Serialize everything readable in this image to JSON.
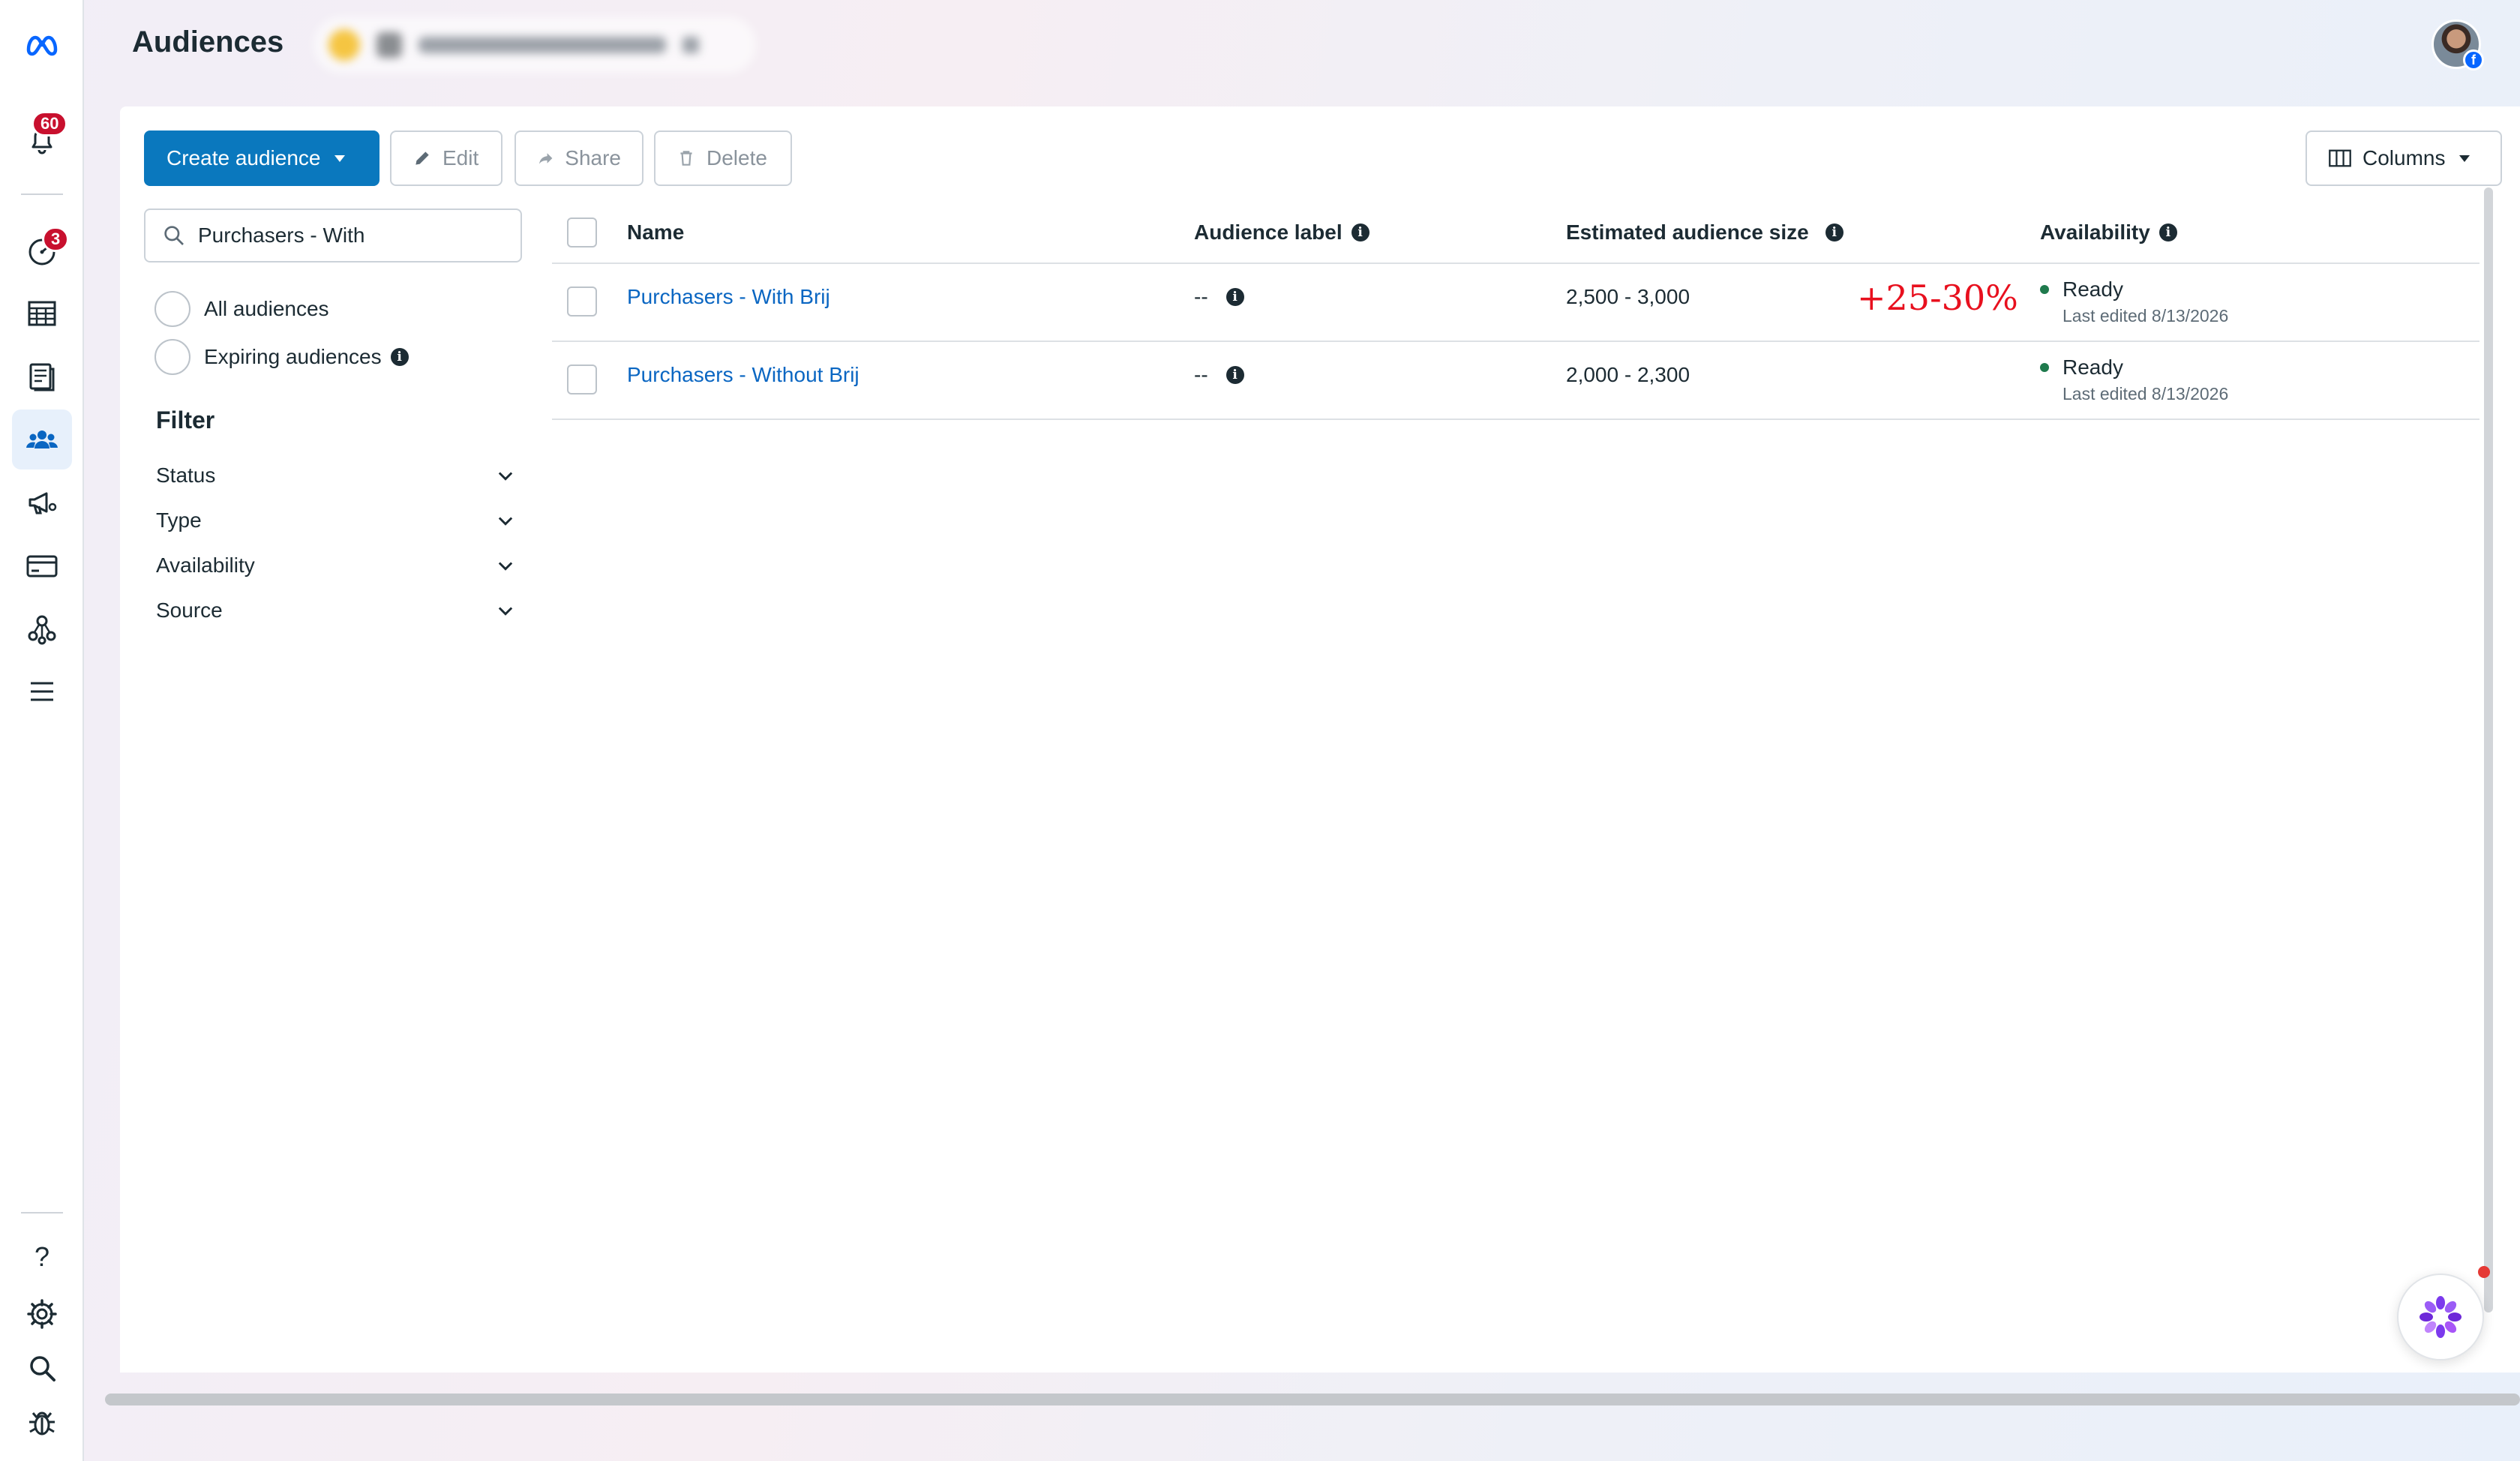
{
  "header": {
    "title": "Audiences"
  },
  "leftnav": {
    "notifications_badge": "60",
    "dashboard_badge": "3",
    "items": [
      {
        "icon": "meta-logo-icon"
      },
      {
        "icon": "bell-icon"
      },
      {
        "icon": "speedometer-icon"
      },
      {
        "icon": "table-icon"
      },
      {
        "icon": "catalog-icon"
      },
      {
        "icon": "audiences-icon"
      },
      {
        "icon": "megaphone-icon"
      },
      {
        "icon": "billing-card-icon"
      },
      {
        "icon": "network-icon"
      },
      {
        "icon": "menu-icon"
      },
      {
        "icon": "help-icon"
      },
      {
        "icon": "settings-icon"
      },
      {
        "icon": "search-icon"
      },
      {
        "icon": "bug-icon"
      }
    ],
    "help_glyph": "?"
  },
  "toolbar": {
    "create_label": "Create audience",
    "edit_label": "Edit",
    "share_label": "Share",
    "delete_label": "Delete",
    "columns_label": "Columns"
  },
  "sidebar": {
    "search_value": "Purchasers - With",
    "all_audiences": "All audiences",
    "expiring_audiences": "Expiring audiences",
    "filter_title": "Filter",
    "filters": [
      "Status",
      "Type",
      "Availability",
      "Source"
    ]
  },
  "table": {
    "headers": {
      "name": "Name",
      "label": "Audience label",
      "size": "Estimated audience size",
      "availability": "Availability"
    },
    "rows": [
      {
        "name": "Purchasers - With Brij",
        "label": "--",
        "size": "2,500 - 3,000",
        "availability": "Ready",
        "edited": "Last edited 8/13/2026"
      },
      {
        "name": "Purchasers - Without Brij",
        "label": "--",
        "size": "2,000 - 2,300",
        "availability": "Ready",
        "edited": "Last edited 8/13/2026"
      }
    ],
    "annotation": "+25-30%"
  },
  "info_glyph": "i",
  "fb_glyph": "f",
  "colors": {
    "primary": "#0a78be",
    "link": "#0a66c2",
    "badge": "#c8102e",
    "annotation": "#e8101e",
    "ready": "#1f7a4d"
  }
}
